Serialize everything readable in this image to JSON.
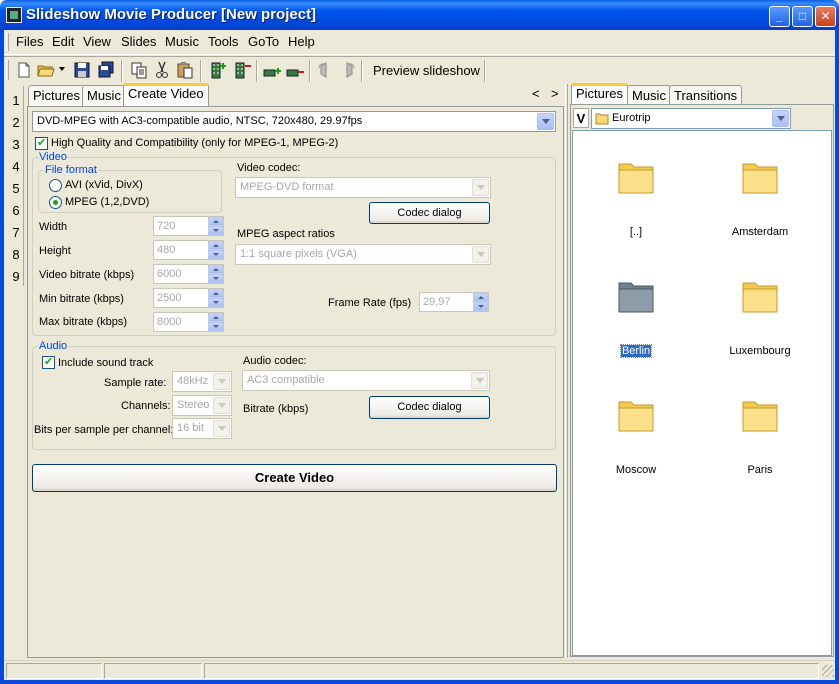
{
  "window": {
    "title": "Slideshow Movie Producer [New project]",
    "caption_buttons": [
      "minimize",
      "maximize",
      "close"
    ]
  },
  "menu": [
    "Files",
    "Edit",
    "View",
    "Slides",
    "Music",
    "Tools",
    "GoTo",
    "Help"
  ],
  "toolbar": {
    "icons": [
      "new-icon",
      "open-icon",
      "dropdown-icon",
      "save-icon",
      "save-all-icon",
      "copy-icon",
      "cut-icon",
      "paste-icon",
      "add-slide-icon",
      "remove-slide-icon",
      "add-music-icon",
      "remove-music-icon",
      "rotate-left-icon",
      "rotate-right-icon"
    ],
    "preview_label": "Preview slideshow"
  },
  "row_numbers": [
    "1",
    "2",
    "3",
    "4",
    "5",
    "6",
    "7",
    "8",
    "9"
  ],
  "left_tabs": {
    "items": [
      "Pictures",
      "Music",
      "Create Video"
    ],
    "active": "Create Video",
    "nav_prev": "<",
    "nav_next": ">"
  },
  "create_video": {
    "preset": "DVD-MPEG with AC3-compatible audio, NTSC, 720x480, 29.97fps",
    "high_quality_label": "High Quality and Compatibility (only for MPEG-1, MPEG-2)",
    "high_quality_checked": true,
    "video": {
      "group_label": "Video",
      "file_format_label": "File format",
      "format_avi": "AVI (xVid, DivX)",
      "format_mpeg": "MPEG (1,2,DVD)",
      "selected_format": "MPEG (1,2,DVD)",
      "width_label": "Width",
      "width": "720",
      "height_label": "Height",
      "height": "480",
      "video_bitrate_label": "Video bitrate (kbps)",
      "video_bitrate": "6000",
      "min_bitrate_label": "Min bitrate (kbps)",
      "min_bitrate": "2500",
      "max_bitrate_label": "Max bitrate (kbps)",
      "max_bitrate": "8000",
      "codec_label": "Video codec:",
      "codec": "MPEG-DVD format",
      "codec_dialog": "Codec dialog",
      "aspect_label": "MPEG aspect ratios",
      "aspect": "1:1 square pixels (VGA)",
      "frame_rate_label": "Frame Rate (fps)",
      "frame_rate": "29,97"
    },
    "audio": {
      "group_label": "Audio",
      "include_sound_label": "Include sound track",
      "include_sound_checked": true,
      "sample_rate_label": "Sample rate:",
      "sample_rate": "48kHz",
      "channels_label": "Channels:",
      "channels": "Stereo",
      "bits_label": "Bits per sample per channel:",
      "bits": "16 bit",
      "codec_label": "Audio codec:",
      "codec": "AC3 compatible",
      "bitrate_label": "Bitrate (kbps)",
      "codec_dialog": "Codec dialog"
    },
    "create_button": "Create Video"
  },
  "right_tabs": {
    "items": [
      "Pictures",
      "Music",
      "Transitions"
    ],
    "active": "Pictures"
  },
  "browser": {
    "view_button": "V",
    "current_folder": "Eurotrip",
    "folders": [
      {
        "name": "[..]",
        "selected": false
      },
      {
        "name": "Amsterdam",
        "selected": false
      },
      {
        "name": "Berlin",
        "selected": true
      },
      {
        "name": "Luxembourg",
        "selected": false
      },
      {
        "name": "Moscow",
        "selected": false
      },
      {
        "name": "Paris",
        "selected": false
      }
    ]
  },
  "colors": {
    "titlebar": "#0054e3",
    "tab_highlight": "#ffc83c",
    "group_label": "#0046d5",
    "selection": "#316ac5",
    "folder_yellow": "#f8d775",
    "folder_gray": "#8a9aa6"
  }
}
